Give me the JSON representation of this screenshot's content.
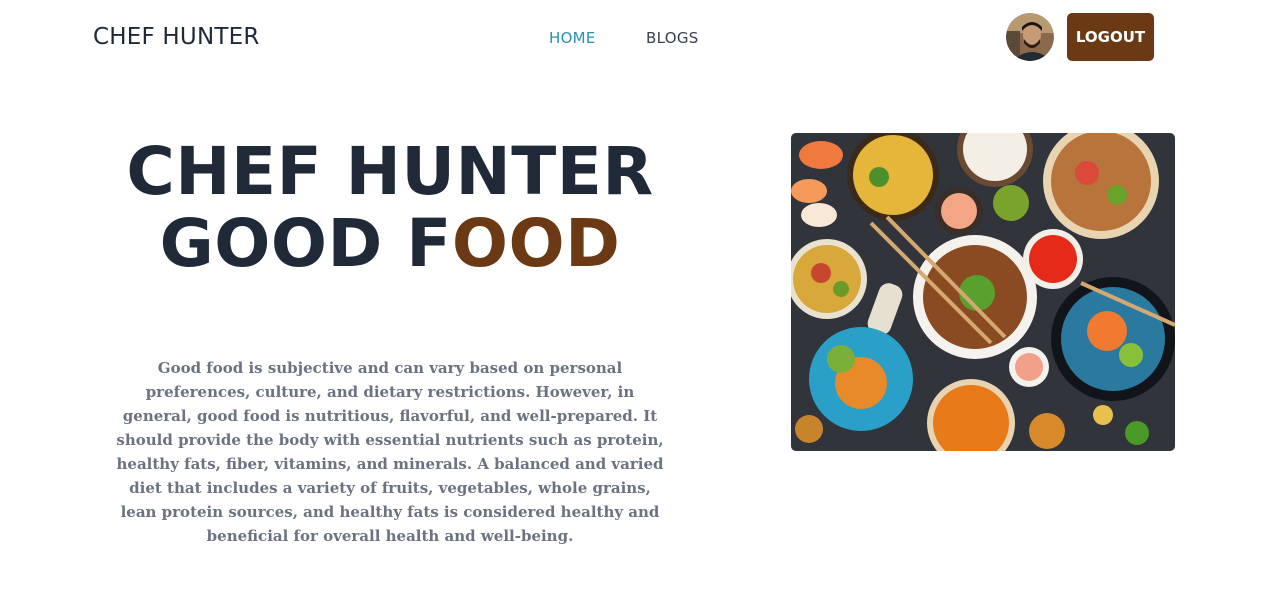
{
  "nav": {
    "brand": "CHEF HUNTER",
    "links": [
      {
        "label": "HOME",
        "active": true
      },
      {
        "label": "BLOGS",
        "active": false
      }
    ],
    "logout_label": "LOGOUT"
  },
  "hero": {
    "title_line1": "CHEF HUNTER",
    "title_line2_part1": "GOOD F",
    "title_line2_part2": "OOD",
    "description": "Good food is subjective and can vary based on personal preferences, culture, and dietary restrictions. However, in general, good food is nutritious, flavorful, and well-prepared. It should provide the body with essential nutrients such as protein, healthy fats, fiber, vitamins, and minerals. A balanced and varied diet that includes a variety of fruits, vegetables, whole grains, lean protein sources, and healthy fats is considered healthy and beneficial for overall health and well-being."
  },
  "colors": {
    "dark": "#1f2937",
    "accent_brown": "#6b3a14",
    "link_active": "#2a8fb0",
    "muted_text": "#6b7280"
  }
}
